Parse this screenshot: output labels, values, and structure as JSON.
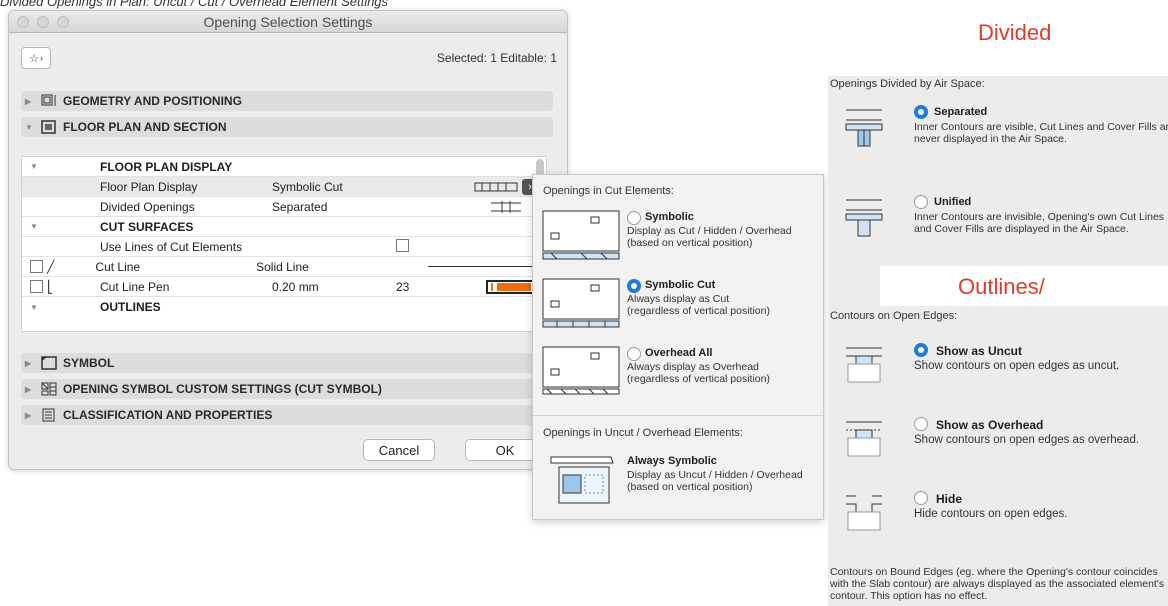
{
  "caption": "Divided Openings in Plan: Uncut / Cut / Overhead Element Settings",
  "dialog": {
    "title": "Opening Selection Settings",
    "selected_info": "Selected: 1 Editable: 1",
    "sections": {
      "geometry": "GEOMETRY AND POSITIONING",
      "floor_plan": "FLOOR PLAN AND SECTION",
      "symbol": "SYMBOL",
      "custom": "OPENING SYMBOL CUSTOM SETTINGS (CUT SYMBOL)",
      "classification": "CLASSIFICATION AND PROPERTIES"
    },
    "table": {
      "group_display": "FLOOR PLAN DISPLAY",
      "floor_plan_display_label": "Floor Plan Display",
      "floor_plan_display_value": "Symbolic Cut",
      "divided_label": "Divided Openings",
      "divided_value": "Separated",
      "group_cut": "CUT SURFACES",
      "use_lines_label": "Use Lines of Cut Elements",
      "cut_line_label": "Cut Line",
      "cut_line_value": "Solid Line",
      "cut_pen_label": "Cut Line Pen",
      "cut_pen_value": "0.20 mm",
      "cut_pen_number": "23",
      "group_outlines": "OUTLINES"
    },
    "cancel": "Cancel",
    "ok": "OK",
    "pen_color": "#f26b10"
  },
  "cut_popup": {
    "header_cut": "Openings in Cut Elements:",
    "symbolic_name": "Symbolic",
    "symbolic_desc1": "Display as Cut / Hidden / Overhead",
    "symbolic_desc2": "(based on vertical position)",
    "symcut_name": "Symbolic Cut",
    "symcut_desc1": "Always display as Cut",
    "symcut_desc2": "(regardless of vertical position)",
    "overhead_name": "Overhead All",
    "overhead_desc1": "Always display as Overhead",
    "overhead_desc2": "(regardless of vertical position)",
    "header_uncut": "Openings in Uncut / Overhead Elements:",
    "always_name": "Always Symbolic",
    "always_desc1": "Display as Uncut / Hidden / Overhead",
    "always_desc2": "(based on vertical position)"
  },
  "divided_panel": {
    "heading": "Divided",
    "header": "Openings Divided by Air Space:",
    "separated_name": "Separated",
    "separated_desc": "Inner Contours are visible, Cut Lines and Cover Fills are never displayed in the Air Space.",
    "unified_name": "Unified",
    "unified_desc": "Inner Contours are invisible, Opening's own Cut Lines and Cover Fills are displayed in the Air Space."
  },
  "outlines_panel": {
    "heading": "Outlines/",
    "header": "Contours on Open Edges:",
    "uncut_name": "Show as Uncut",
    "uncut_desc": "Show contours on open edges as uncut.",
    "overhead_name": "Show as Overhead",
    "overhead_desc": "Show contours on open edges as overhead.",
    "hide_name": "Hide",
    "hide_desc": "Hide contours on open edges.",
    "note": "Contours on Bound Edges (eg. where the Opening's contour coincides with the Slab contour) are always displayed as the associated element's contour. This option has no effect."
  }
}
